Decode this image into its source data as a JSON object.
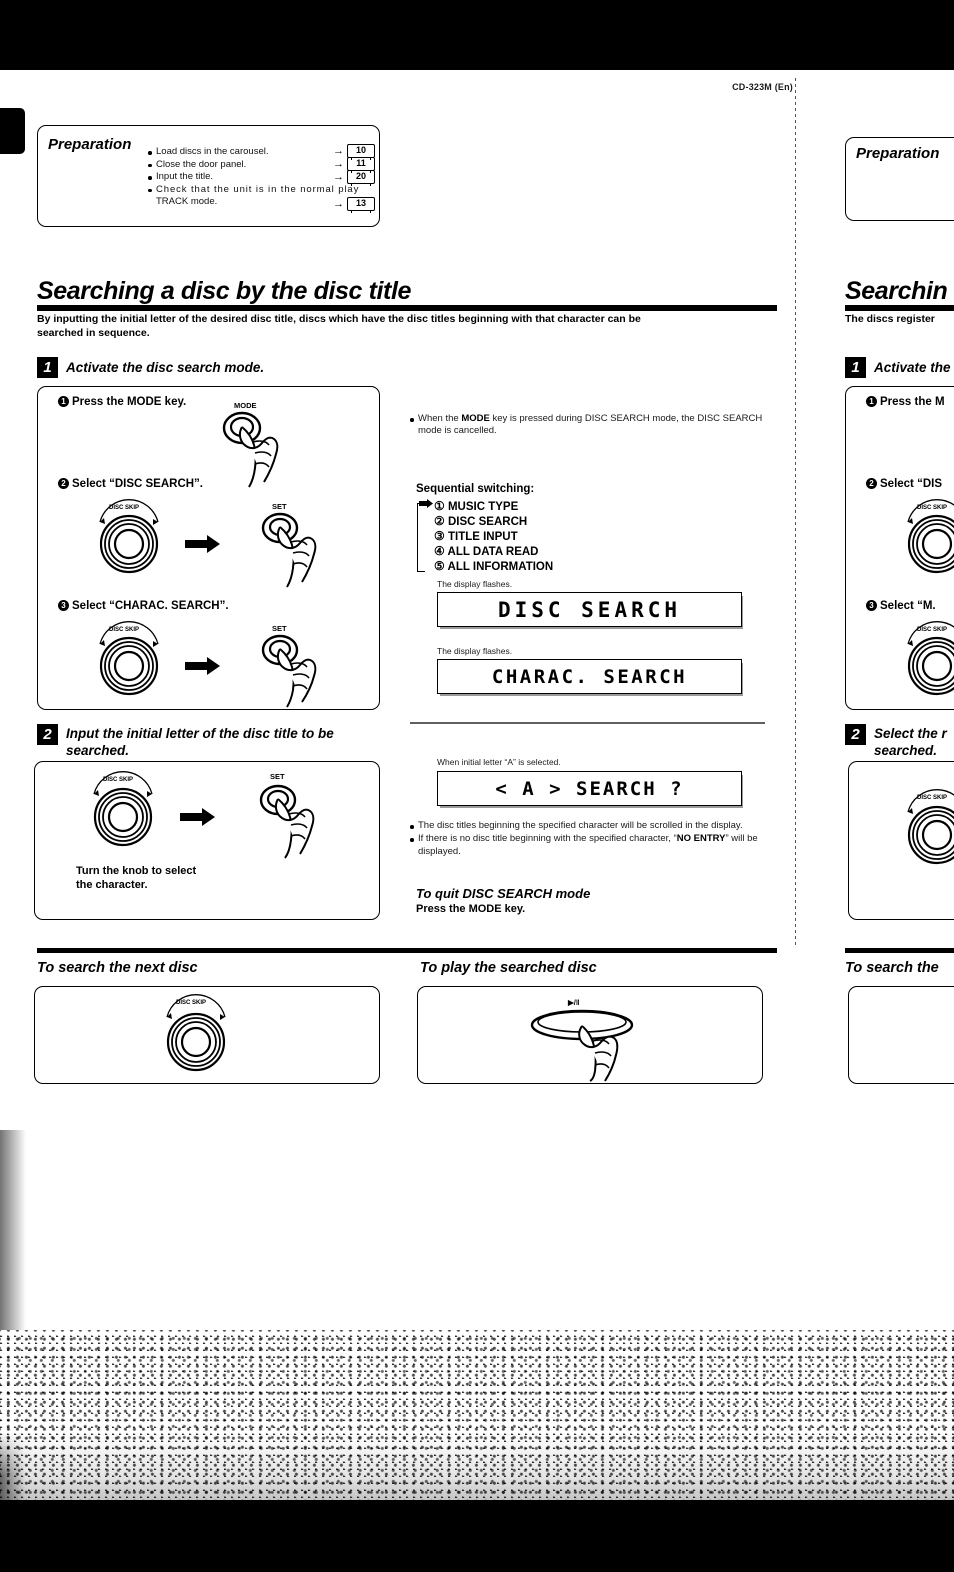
{
  "header": {
    "model": "CD-323M (En)"
  },
  "preparation": {
    "title": "Preparation",
    "items": [
      {
        "text": "Load discs in the carousel.",
        "page": "10"
      },
      {
        "text": "Close the door panel.",
        "page": "11"
      },
      {
        "text": "Input the title.",
        "page": "20"
      },
      {
        "text": "Check that the unit is in the normal play",
        "text2": "TRACK mode.",
        "page": "13"
      }
    ]
  },
  "section": {
    "title": "Searching a disc by the disc title",
    "lead1": "By inputting the initial letter of the desired disc title, discs which have the disc titles beginning with that character can be",
    "lead2": "searched in sequence."
  },
  "step1": {
    "badge": "1",
    "title": "Activate the disc search mode.",
    "sub1": "Press the MODE key.",
    "sub2": "Select “DISC SEARCH”.",
    "sub3": "Select “CHARAC. SEARCH”.",
    "key_mode": "MODE",
    "key_set": "SET",
    "knob_label": "DISC SKIP"
  },
  "step1_right": {
    "note1": "When the ",
    "note1_b": "MODE",
    "note1_c": " key is pressed during DISC SEARCH mode, the DISC",
    "note2": "SEARCH mode is cancelled.",
    "seq_head": "Sequential switching:",
    "seq_items": [
      {
        "num": "①",
        "label": "MUSIC TYPE"
      },
      {
        "num": "②",
        "label": "DISC SEARCH"
      },
      {
        "num": "③",
        "label": "TITLE INPUT"
      },
      {
        "num": "④",
        "label": "ALL DATA READ"
      },
      {
        "num": "⑤",
        "label": "ALL INFORMATION"
      }
    ],
    "flash_cap1": "The display flashes.",
    "lcd1": "DISC SEARCH",
    "flash_cap2": "The display flashes.",
    "lcd2": "CHARAC. SEARCH"
  },
  "step2": {
    "badge": "2",
    "title1": "Input the initial letter of the disc title to be",
    "title2": "searched.",
    "knob_label": "DISC SKIP",
    "key_set": "SET",
    "hint1": "Turn the knob to select",
    "hint2": "the character."
  },
  "step2_right": {
    "lcd_cap": "When initial letter “A” is selected.",
    "lcd": "< A >  SEARCH  ?",
    "bullet1": "The disc titles beginning the specified character will be scrolled in the",
    "bullet1b": "display.",
    "bullet2a": "If there is no disc title beginning with the specified character, “",
    "bullet2b": "NO",
    "bullet2c": "ENTRY",
    "bullet2d": "” will be displayed.",
    "quit_head": "To quit DISC SEARCH mode",
    "quit_body": "Press the MODE key."
  },
  "bottom": {
    "left_title": "To search the next disc",
    "left_knob_label": "DISC SKIP",
    "right_title": "To play the searched disc",
    "right_key": "▶/‖"
  },
  "next_page": {
    "prep_title": "Preparation",
    "section_title_partial": "Searchin",
    "lead_partial": "The discs register",
    "step1_badge": "1",
    "step1_title_partial": "Activate the",
    "sub1_partial": "Press the M",
    "sub2_partial": "Select “DIS",
    "sub3_partial": "Select “M.",
    "step2_badge": "2",
    "step2_title_partial": "Select the r",
    "step2_title_partial2": "searched.",
    "bottom_title_partial": "To search the",
    "knob_label": "DISC SKI"
  }
}
